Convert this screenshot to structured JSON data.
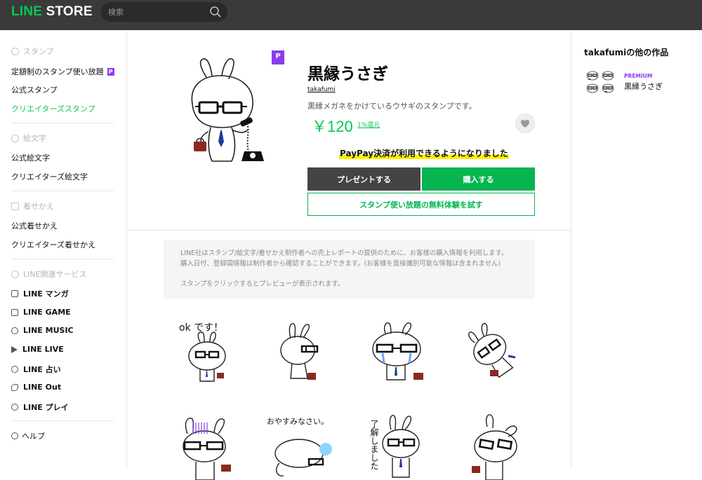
{
  "header": {
    "logo_line": "LINE",
    "logo_store": "STORE",
    "search_placeholder": "検索"
  },
  "sidebar": {
    "sections": [
      {
        "label": "スタンプ",
        "items": [
          "定額制のスタンプ使い放題",
          "公式スタンプ",
          "クリエイターズスタンプ"
        ]
      },
      {
        "label": "絵文字",
        "items": [
          "公式絵文字",
          "クリエイターズ絵文字"
        ]
      },
      {
        "label": "着せかえ",
        "items": [
          "公式着せかえ",
          "クリエイターズ着せかえ"
        ]
      }
    ],
    "subscription_badge": "P",
    "services_label": "LINE関連サービス",
    "services": [
      "LINE マンガ",
      "LINE GAME",
      "LINE MUSIC",
      "LINE LIVE",
      "LINE 占い",
      "LINE Out",
      "LINE プレイ"
    ],
    "help": "ヘルプ"
  },
  "product": {
    "premium_badge": "P",
    "title": "黒縁うさぎ",
    "author": "takafumi",
    "description": "黒縁メガネをかけているウサギのスタンプです。",
    "price": "￥120",
    "refund": "1%還元",
    "paypay_notice": "PayPay決済が利用できるようになりました",
    "present_button": "プレゼントする",
    "buy_button": "購入する",
    "trial_button": "スタンプ使い放題の無料体験を試す"
  },
  "notice": {
    "line1": "LINE社はスタンプ/絵文字/着せかえ制作者への売上レポートの提供のために、お客様の購入情報を利用します。",
    "line2": "購入日付、登録国情報は制作者から確認することができます。(お客様を直接識別可能な情報は含まれません)",
    "line3": "スタンプをクリックするとプレビューが表示されます。"
  },
  "stickers": {
    "s1_text": "ok です！",
    "s6_text": "おやすみなさい。",
    "s7_text": "了解しました"
  },
  "related": {
    "title": "takafumiの他の作品",
    "premium": "PREMIUM",
    "name": "黒縁うさぎ"
  },
  "colors": {
    "brand_green": "#06c755",
    "premium_purple": "#8a3df0",
    "header_bg": "#3a3a3a"
  }
}
